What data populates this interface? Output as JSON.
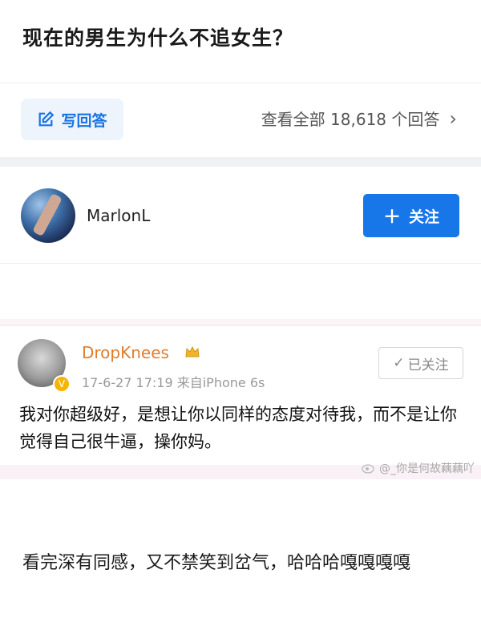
{
  "question": {
    "title": "现在的男生为什么不追女生？"
  },
  "answer_bar": {
    "write_label": "写回答",
    "view_all_label": "查看全部 18,618 个回答",
    "chevron": "›"
  },
  "author": {
    "name": "MarlonL",
    "follow_label": "关注",
    "follow_plus": "＋"
  },
  "weibo": {
    "username": "DropKnees",
    "meta": "17-6-27 17:19  来自iPhone 6s",
    "followed_label": "已关注",
    "check": "✓",
    "content": "我对你超级好，是想让你以同样的态度对待我，而不是让你觉得自己很牛逼，操你妈。",
    "watermark": "@_你是何故藕藕吖"
  },
  "comment": {
    "text": "看完深有同感，又不禁笑到岔气，哈哈哈嘎嘎嘎嘎"
  },
  "colors": {
    "accent": "#1776e8",
    "username_orange": "#e07c2c",
    "badge_gold": "#f5b500"
  }
}
